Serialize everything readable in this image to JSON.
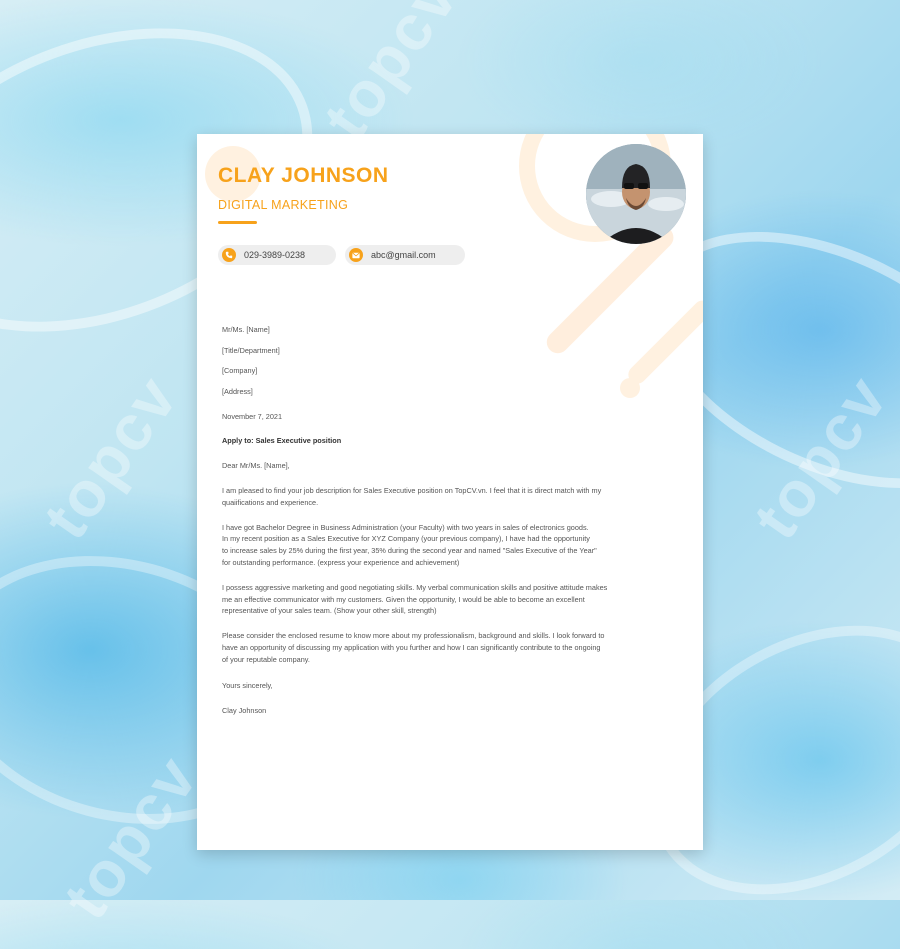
{
  "header": {
    "name": "CLAY JOHNSON",
    "role": "DIGITAL MARKETING"
  },
  "contacts": {
    "phone": "029-3989-0238",
    "email": "abc@gmail.com"
  },
  "letter": {
    "recipient_name": "Mr/Ms. [Name]",
    "recipient_title": "[Title/Department]",
    "recipient_company": "[Company]",
    "recipient_address": "[Address]",
    "date": "November 7, 2021",
    "subject": "Apply to: Sales Executive position",
    "greeting": "Dear Mr/Ms. [Name],",
    "para1_line1": "I am pleased to find your job description for Sales Executive position on TopCV.vn. I feel that it is direct match with my",
    "para1_line2": "quaiifications and experience.",
    "para2_line1": "I have got Bachelor Degree in Business Administration (your Faculty) with two years in sales of electronics goods.",
    "para2_line2": "In my recent position as a Sales Executive for XYZ Company (your previous company), I have had the opportunity",
    "para2_line3": "to increase sales by 25% during the first year, 35% during the second year and named \"Sales Executive of the Year\"",
    "para2_line4": "for outstanding performance. (express your experience and achievement)",
    "para3_line1": "I possess aggressive marketing and good negotiating skills. My verbal communication skills and positive attitude makes",
    "para3_line2": "me an effective communicator with my customers. Given the opportunity, I would be able to become an excellent",
    "para3_line3": "representative of your sales team. (Show your other skill, strength)",
    "para4_line1": "Please consider the enclosed resume to know more about my professionalism, background and skills. I look forward to",
    "para4_line2": "have an opportunity of discussing my application with you further and how I can significantly contribute to the ongoing",
    "para4_line3": "of your reputable company.",
    "closing": "Yours sincerely,",
    "signature": "Clay Johnson"
  },
  "colors": {
    "accent": "#f7a21b",
    "background": "#bfe5f2"
  },
  "icons": {
    "phone": "phone-icon",
    "email": "envelope-icon"
  }
}
